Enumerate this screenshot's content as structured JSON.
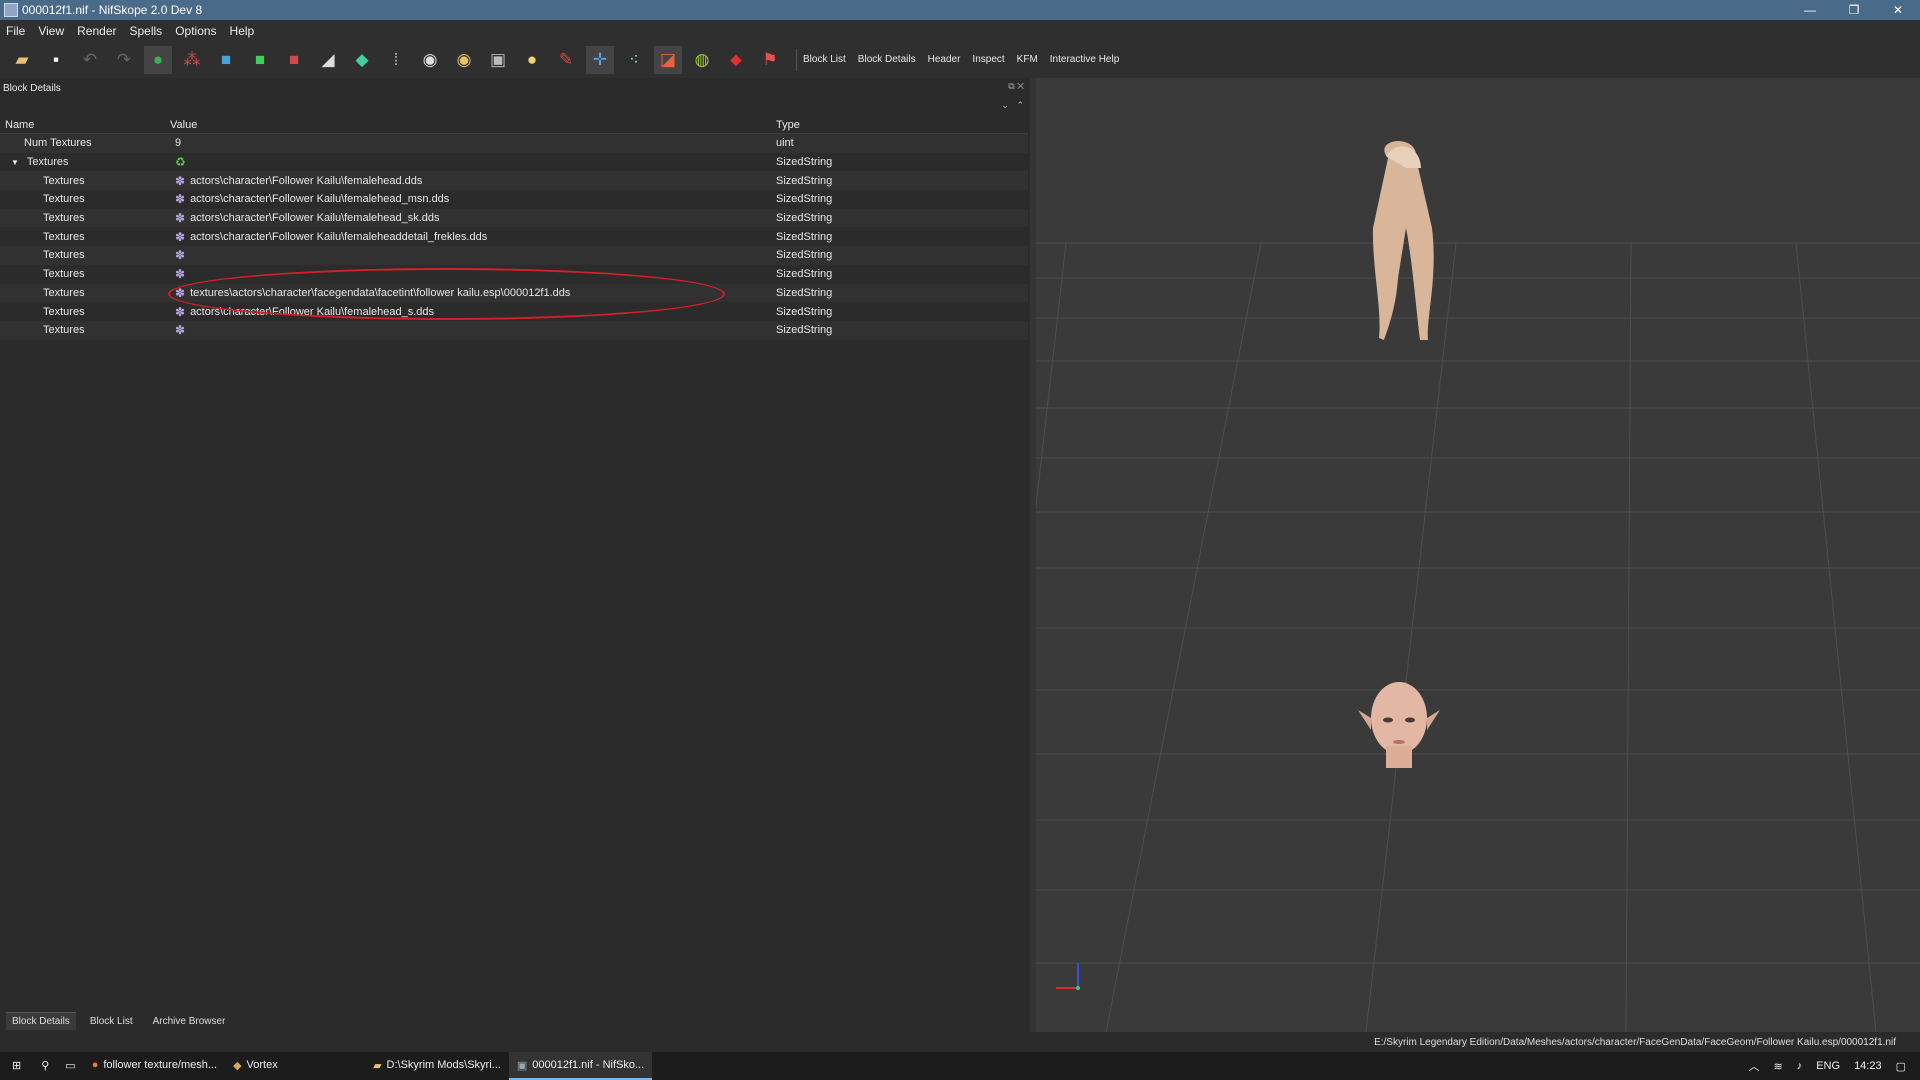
{
  "window": {
    "title": "000012f1.nif - NifSkope 2.0 Dev 8",
    "minimize": "—",
    "maximize": "❐",
    "close": "✕"
  },
  "menu": [
    "File",
    "View",
    "Render",
    "Spells",
    "Options",
    "Help"
  ],
  "toolbar": {
    "text_buttons": [
      "Block List",
      "Block Details",
      "Header",
      "Inspect",
      "KFM",
      "Interactive Help"
    ]
  },
  "dock": {
    "title": "Block Details"
  },
  "table": {
    "headers": {
      "name": "Name",
      "value": "Value",
      "type": "Type"
    },
    "rows": [
      {
        "name": "Num Textures",
        "value": "9",
        "type": "uint"
      },
      {
        "name": "Textures",
        "value": "",
        "type": "SizedString"
      },
      {
        "name": "Textures",
        "value": "actors\\character\\Follower Kailu\\femalehead.dds",
        "type": "SizedString"
      },
      {
        "name": "Textures",
        "value": "actors\\character\\Follower Kailu\\femalehead_msn.dds",
        "type": "SizedString"
      },
      {
        "name": "Textures",
        "value": "actors\\character\\Follower Kailu\\femalehead_sk.dds",
        "type": "SizedString"
      },
      {
        "name": "Textures",
        "value": "actors\\character\\Follower Kailu\\femaleheaddetail_frekles.dds",
        "type": "SizedString"
      },
      {
        "name": "Textures",
        "value": "",
        "type": "SizedString"
      },
      {
        "name": "Textures",
        "value": "",
        "type": "SizedString"
      },
      {
        "name": "Textures",
        "value": "textures\\actors\\character\\facegendata\\facetint\\follower kailu.esp\\000012f1.dds",
        "type": "SizedString"
      },
      {
        "name": "Textures",
        "value": "actors\\character\\Follower Kailu\\femalehead_s.dds",
        "type": "SizedString"
      },
      {
        "name": "Textures",
        "value": "",
        "type": "SizedString"
      }
    ]
  },
  "bottom_tabs": [
    "Block Details",
    "Block List",
    "Archive Browser"
  ],
  "status": {
    "path": "E:/Skyrim Legendary Edition/Data/Meshes/actors/character/FaceGenData/FaceGeom/Follower Kailu.esp/000012f1.nif"
  },
  "taskbar": {
    "tasks": [
      "follower texture/mesh...",
      "Vortex",
      "D:\\Skyrim Mods\\Skyri...",
      "000012f1.nif - NifSko..."
    ],
    "language": "ENG",
    "time": "14:23"
  },
  "colors": {
    "titlebar": "#4a6a8a",
    "highlight_circle": "#d21f2a",
    "viewport": "#3a3a3a"
  }
}
